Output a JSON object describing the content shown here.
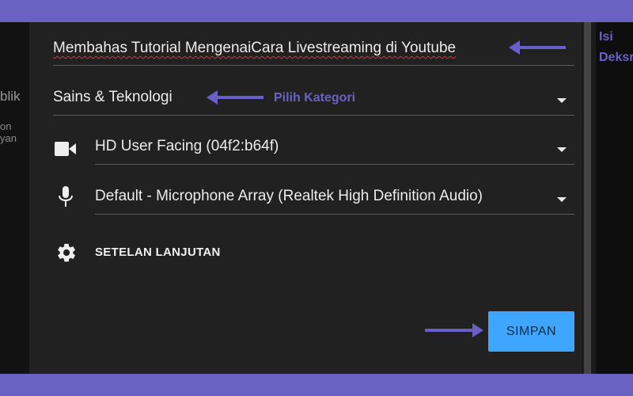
{
  "background_text": {
    "left_partial_1": "blik",
    "left_partial_2": "on yan"
  },
  "form": {
    "title_value": "Membahas Tutorial MengenaiCara Livestreaming di Youtube",
    "category_value": "Sains & Teknologi",
    "camera_value": "HD User Facing (04f2:b64f)",
    "mic_value": "Default - Microphone Array (Realtek High Definition Audio)",
    "advanced_label": "SETELAN LANJUTAN",
    "save_label": "SIMPAN"
  },
  "annotations": {
    "isi": "Isi",
    "deskripsi": "Deksrips",
    "pilih_kategori": "Pilih Kategori"
  },
  "icons": {
    "camera": "videocam-icon",
    "mic": "microphone-icon",
    "settings": "gear-icon",
    "dropdown": "chevron-down-icon"
  },
  "colors": {
    "accent_purple": "#6a62c3",
    "button_blue": "#3ea6ff",
    "dialog_bg": "#212121"
  }
}
